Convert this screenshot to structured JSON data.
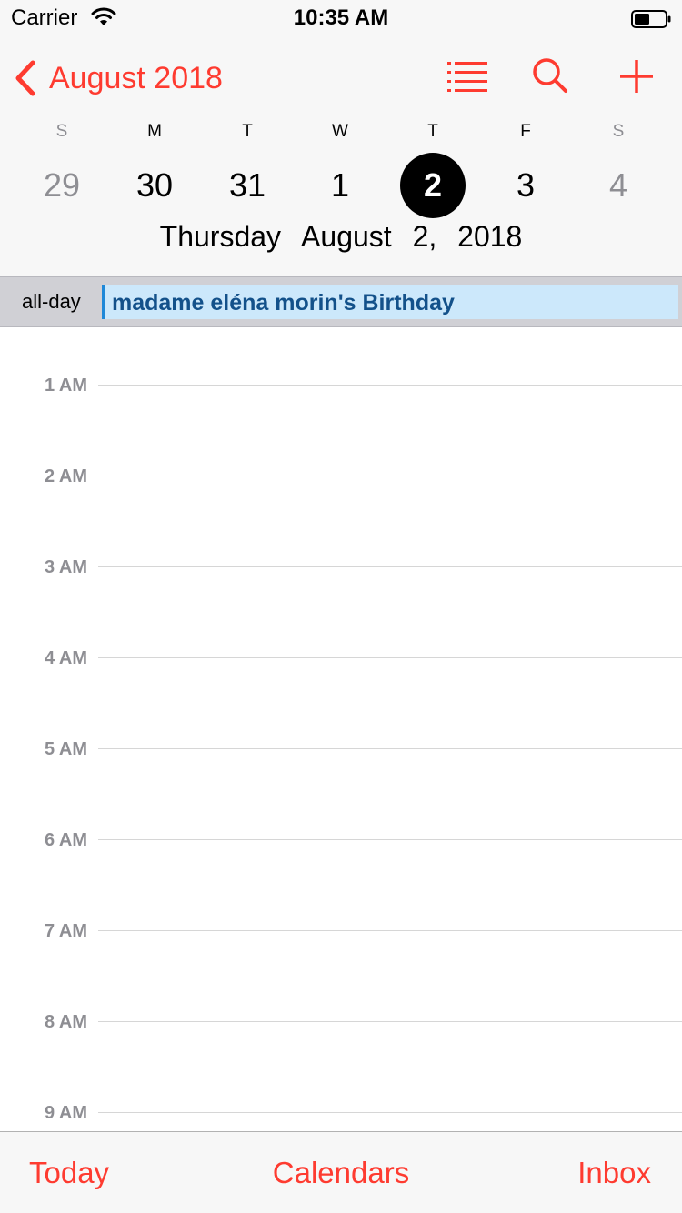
{
  "status_bar": {
    "carrier": "Carrier",
    "time": "10:35 AM"
  },
  "header": {
    "back_label": "August 2018",
    "accent_color": "#fe3b30",
    "icons": [
      "list-icon",
      "search-icon",
      "add-icon"
    ]
  },
  "week": {
    "weekdays": [
      "S",
      "M",
      "T",
      "W",
      "T",
      "F",
      "S"
    ],
    "days": [
      "29",
      "30",
      "31",
      "1",
      "2",
      "3",
      "4"
    ],
    "selected_day": "2"
  },
  "date_title": {
    "weekday": "Thursday",
    "date": "August 2, 2018"
  },
  "all_day": {
    "label": "all-day",
    "event_title": "madame eléna morin's Birthday"
  },
  "hours": [
    "1 AM",
    "2 AM",
    "3 AM",
    "4 AM",
    "5 AM",
    "6 AM",
    "7 AM",
    "8 AM",
    "9 AM"
  ],
  "tab_bar": {
    "today": "Today",
    "calendars": "Calendars",
    "inbox": "Inbox"
  }
}
